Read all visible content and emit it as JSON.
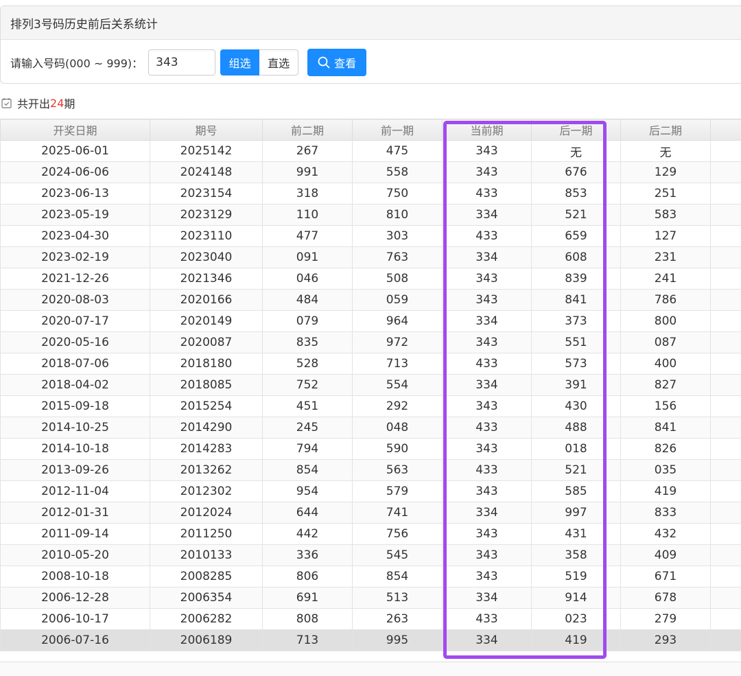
{
  "panel": {
    "title": "排列3号码历史前后关系统计",
    "input_label": "请输入号码(000 ~ 999)：",
    "input_value": "343",
    "mode_options": [
      "组选",
      "直选"
    ],
    "selected_mode": "组选",
    "search_label": "查看"
  },
  "summary": {
    "prefix": "共开出",
    "count": "24",
    "suffix": "期"
  },
  "table": {
    "headers": [
      "开奖日期",
      "期号",
      "前二期",
      "前一期",
      "当前期",
      "后一期",
      "后二期",
      ""
    ],
    "rows": [
      [
        "2025-06-01",
        "2025142",
        "267",
        "475",
        "343",
        "无",
        "无"
      ],
      [
        "2024-06-06",
        "2024148",
        "991",
        "558",
        "343",
        "676",
        "129"
      ],
      [
        "2023-06-13",
        "2023154",
        "318",
        "750",
        "433",
        "853",
        "251"
      ],
      [
        "2023-05-19",
        "2023129",
        "110",
        "810",
        "334",
        "521",
        "583"
      ],
      [
        "2023-04-30",
        "2023110",
        "477",
        "303",
        "433",
        "659",
        "127"
      ],
      [
        "2023-02-19",
        "2023040",
        "091",
        "763",
        "334",
        "608",
        "231"
      ],
      [
        "2021-12-26",
        "2021346",
        "046",
        "508",
        "343",
        "839",
        "241"
      ],
      [
        "2020-08-03",
        "2020166",
        "484",
        "059",
        "343",
        "841",
        "786"
      ],
      [
        "2020-07-17",
        "2020149",
        "079",
        "964",
        "334",
        "373",
        "800"
      ],
      [
        "2020-05-16",
        "2020087",
        "835",
        "972",
        "343",
        "551",
        "087"
      ],
      [
        "2018-07-06",
        "2018180",
        "528",
        "713",
        "433",
        "573",
        "400"
      ],
      [
        "2018-04-02",
        "2018085",
        "752",
        "554",
        "334",
        "391",
        "827"
      ],
      [
        "2015-09-18",
        "2015254",
        "451",
        "292",
        "343",
        "430",
        "156"
      ],
      [
        "2014-10-25",
        "2014290",
        "245",
        "048",
        "433",
        "488",
        "841"
      ],
      [
        "2014-10-18",
        "2014283",
        "794",
        "590",
        "343",
        "018",
        "826"
      ],
      [
        "2013-09-26",
        "2013262",
        "854",
        "563",
        "433",
        "521",
        "035"
      ],
      [
        "2012-11-04",
        "2012302",
        "954",
        "579",
        "343",
        "585",
        "419"
      ],
      [
        "2012-01-31",
        "2012024",
        "644",
        "741",
        "334",
        "997",
        "833"
      ],
      [
        "2011-09-14",
        "2011250",
        "442",
        "756",
        "343",
        "431",
        "432"
      ],
      [
        "2010-05-20",
        "2010133",
        "336",
        "545",
        "343",
        "358",
        "409"
      ],
      [
        "2008-10-18",
        "2008285",
        "806",
        "854",
        "343",
        "519",
        "671"
      ],
      [
        "2006-12-28",
        "2006354",
        "691",
        "513",
        "334",
        "914",
        "678"
      ],
      [
        "2006-10-17",
        "2006282",
        "808",
        "263",
        "433",
        "023",
        "279"
      ],
      [
        "2006-07-16",
        "2006189",
        "713",
        "995",
        "334",
        "419",
        "293"
      ]
    ],
    "selected_row": 23
  },
  "colors": {
    "accent": "#1a8cff",
    "count_red": "#e53935",
    "highlight_purple": "#a04af0"
  }
}
